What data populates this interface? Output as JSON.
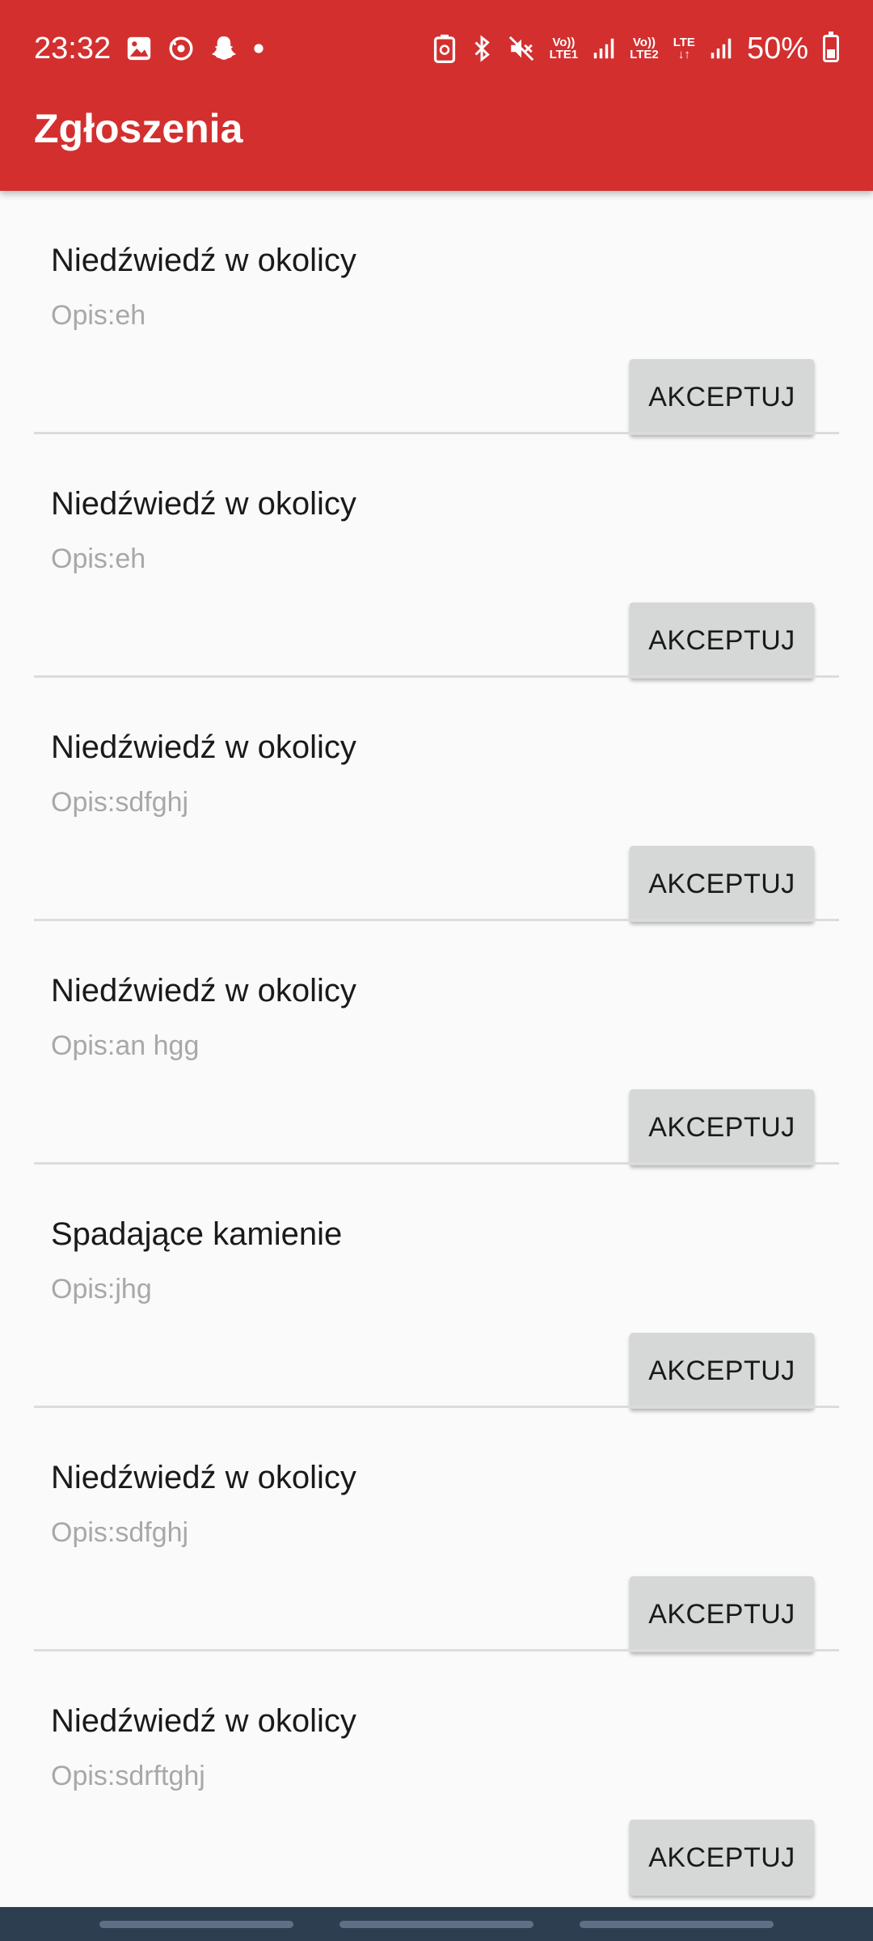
{
  "status_bar": {
    "time": "23:32",
    "battery": "50%",
    "battery_level": 0.5,
    "sim1_top": "Vo))",
    "sim1_bottom": "LTE1",
    "sim2_top": "Vo))",
    "sim2_bottom": "LTE2",
    "lte_label": "LTE",
    "icons": [
      "gallery-icon",
      "sync-icon",
      "snapchat-icon",
      "dot-icon",
      "battery-saver-icon",
      "bluetooth-icon",
      "mute-icon",
      "signal-icon",
      "battery-icon"
    ]
  },
  "app_bar": {
    "title": "Zgłoszenia"
  },
  "colors": {
    "accent": "#d32f2f",
    "button": "#d6d7d7",
    "nav": "#2d3e50"
  },
  "reports": [
    {
      "title": "Niedźwiedź w okolicy",
      "description": "Opis:eh",
      "button": "AKCEPTUJ"
    },
    {
      "title": "Niedźwiedź w okolicy",
      "description": "Opis:eh",
      "button": "AKCEPTUJ"
    },
    {
      "title": "Niedźwiedź w okolicy",
      "description": "Opis:sdfghj",
      "button": "AKCEPTUJ"
    },
    {
      "title": "Niedźwiedź w okolicy",
      "description": "Opis:an hgg",
      "button": "AKCEPTUJ"
    },
    {
      "title": "Spadające kamienie",
      "description": "Opis:jhg",
      "button": "AKCEPTUJ"
    },
    {
      "title": "Niedźwiedź w okolicy",
      "description": "Opis:sdfghj",
      "button": "AKCEPTUJ"
    },
    {
      "title": "Niedźwiedź w okolicy",
      "description": "Opis:sdrftghj",
      "button": "AKCEPTUJ"
    }
  ]
}
